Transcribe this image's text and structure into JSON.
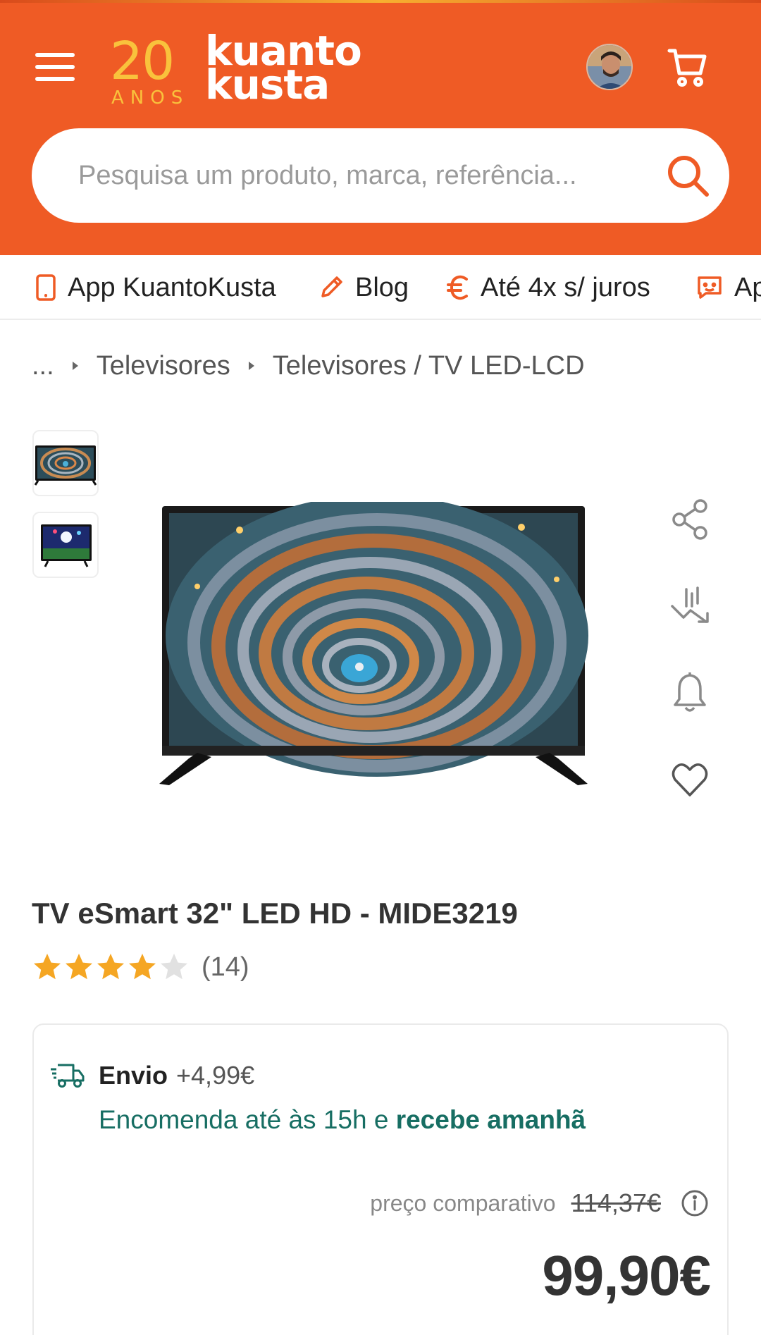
{
  "brand": {
    "logo_20": "20",
    "logo_anos": "ANOS",
    "logo_kuanto": "kuanto",
    "logo_kusta": "kusta",
    "primary_color": "#EF5B25",
    "accent_color": "#F9C23C"
  },
  "header": {
    "menu_icon": "hamburger-menu-icon",
    "avatar": "user-avatar",
    "cart_icon": "shopping-cart-icon"
  },
  "search": {
    "placeholder": "Pesquisa um produto, marca, referência...",
    "icon": "search-icon"
  },
  "quicklinks": [
    {
      "label": "App KuantoKusta",
      "icon": "phone-icon"
    },
    {
      "label": "Blog",
      "icon": "pencil-icon"
    },
    {
      "label": "Até 4x s/ juros",
      "icon": "euro-icon"
    },
    {
      "label": "Ap",
      "icon": "chat-icon"
    }
  ],
  "breadcrumb": {
    "ellipsis": "...",
    "items": [
      "Televisores",
      "Televisores / TV LED-LCD"
    ]
  },
  "product": {
    "title": "TV eSmart 32\" LED HD - MIDE3219",
    "rating_value": 4,
    "rating_max": 5,
    "rating_count": "(14)",
    "actions": [
      "share-icon",
      "price-history-icon",
      "bell-alert-icon",
      "heart-favorite-icon"
    ]
  },
  "offer": {
    "shipping_label": "Envio",
    "shipping_price": "+4,99€",
    "delivery_prefix": "Encomenda até às 15h e ",
    "delivery_bold": "recebe amanhã",
    "compare_label": "preço comparativo",
    "old_price": "114,37€",
    "price": "99,90€",
    "delivery_color": "#176e63"
  }
}
